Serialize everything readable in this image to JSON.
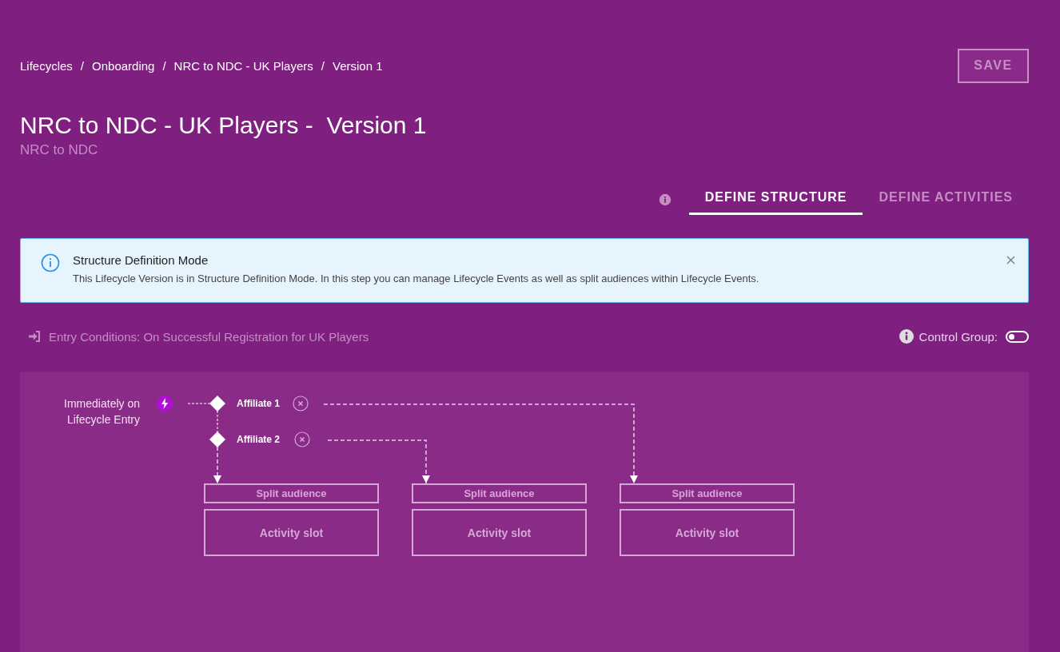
{
  "breadcrumb": {
    "separator": "/",
    "items": [
      {
        "label": "Lifecycles"
      },
      {
        "label": "Onboarding"
      },
      {
        "label": "NRC to NDC - UK Players"
      },
      {
        "label": "Version 1"
      }
    ]
  },
  "save_button": {
    "label": "SAVE",
    "disabled": true
  },
  "title": "NRC to NDC - UK Players -  Version 1",
  "subtitle": "NRC to NDC",
  "tabs": [
    {
      "label": "DEFINE STRUCTURE",
      "selected": true
    },
    {
      "label": "DEFINE ACTIVITIES",
      "selected": false
    }
  ],
  "alert": {
    "title": "Structure Definition Mode",
    "message": "This Lifecycle Version is in Structure Definition Mode. In this step you can manage Lifecycle Events as well as split audiences within Lifecycle Events."
  },
  "entry_conditions": "Entry Conditions: On Successful Registration for UK Players",
  "control_group": {
    "label": "Control Group:",
    "on": false
  },
  "diagram": {
    "trigger": "Immediately on Lifecycle Entry",
    "branches": [
      {
        "label": "Affiliate 1"
      },
      {
        "label": "Affiliate 2"
      }
    ],
    "slots": [
      {
        "split": "Split audience",
        "activity": "Activity slot"
      },
      {
        "split": "Split audience",
        "activity": "Activity slot"
      },
      {
        "split": "Split audience",
        "activity": "Activity slot"
      }
    ]
  }
}
